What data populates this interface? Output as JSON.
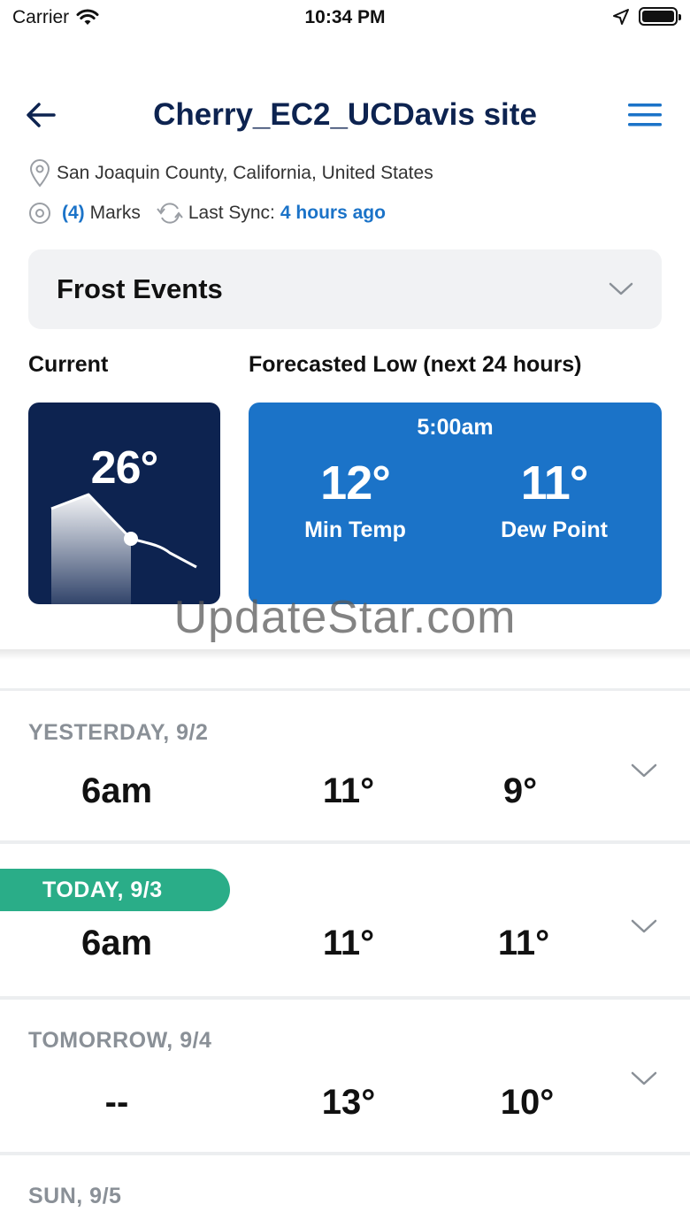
{
  "status_bar": {
    "carrier": "Carrier",
    "time": "10:34 PM"
  },
  "header": {
    "title": "Cherry_EC2_UCDavis site"
  },
  "location": "San Joaquin County, California, United States",
  "marks": {
    "count": "(4)",
    "label": "Marks"
  },
  "sync": {
    "label": "Last Sync:",
    "value": "4 hours ago"
  },
  "dropdown": {
    "selected": "Frost Events"
  },
  "current": {
    "heading": "Current",
    "temp": "26°"
  },
  "forecast": {
    "heading": "Forecasted Low (next 24 hours)",
    "time": "5:00am",
    "min_temp": "12°",
    "min_temp_label": "Min Temp",
    "dew_point": "11°",
    "dew_point_label": "Dew Point"
  },
  "watermark": "UpdateStar.com",
  "rows": [
    {
      "date": "YESTERDAY, 9/2",
      "time": "6am",
      "min": "11°",
      "dew": "9°"
    },
    {
      "date": "TODAY, 9/3",
      "time": "6am",
      "min": "11°",
      "dew": "11°"
    },
    {
      "date": "TOMORROW, 9/4",
      "time": "--",
      "min": "13°",
      "dew": "10°"
    },
    {
      "date": "SUN, 9/5"
    }
  ],
  "colors": {
    "navy": "#0d2350",
    "blue": "#1b73c8",
    "green": "#2aad88"
  }
}
